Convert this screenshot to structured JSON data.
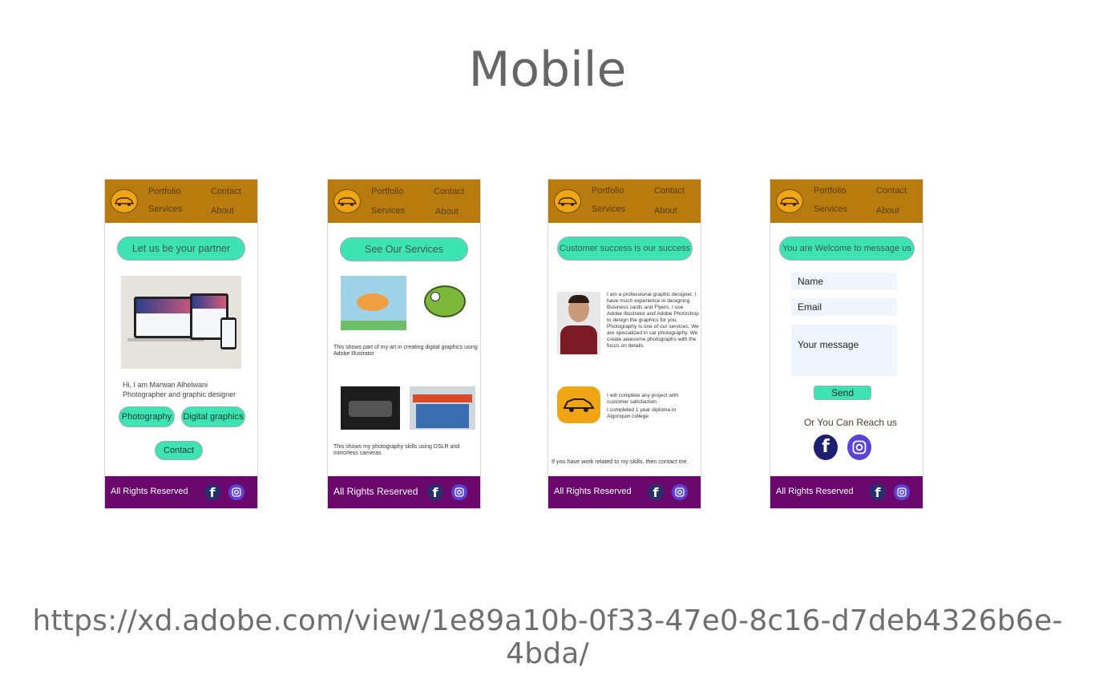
{
  "slide": {
    "title": "Mobile",
    "url": "https://xd.adobe.com/view/1e89a10b-0f33-47e0-8c16-d7deb4326b6e-4bda/"
  },
  "nav": {
    "portfolio": "Portfolio",
    "contact": "Contact",
    "services": "Services",
    "about": "About"
  },
  "footer": {
    "text": "All Rights Reserved",
    "icons": [
      "facebook-icon",
      "instagram-icon"
    ]
  },
  "screens": {
    "home": {
      "heading": "Let us be your partner",
      "intro_line1": "Hi, I am Marwan Alhelwani",
      "intro_line2": "Photographer and graphic designer",
      "btn_photography": "Photography",
      "btn_digital": "Digital graphics",
      "btn_contact": "Contact"
    },
    "services": {
      "heading": "See Our Services",
      "caption_graphics": "This shows part of my art in creating digital graphics using Adobe Illustrator",
      "caption_photo": "This shows my photography skills using DSLR and mirrorless cameras"
    },
    "about": {
      "heading": "Customer success is our success",
      "bio": "I am a professional graphic designer. I have much experience in designing Business cards and Flyers. I use Adobe Illustrator and Adobe Photoshop to design the graphics for you. Photography is one of our services. We are specialized in car photography. We create awesome photographs with the focus on details",
      "promise_line1": "I will complete any project with customer satisfaction.",
      "promise_line2": "I completed 1 year diploma in Algonquin college",
      "contact_note": "If you have work related to my skills, then contact me."
    },
    "contact": {
      "heading": "You are Welcome to message us",
      "name_placeholder": "Name",
      "email_placeholder": "Email",
      "message_placeholder": "Your message",
      "send_label": "Send",
      "reach_text": "Or You Can Reach us"
    }
  },
  "colors": {
    "header": "#b77c0d",
    "footer": "#6a086e",
    "accent": "#3ee3b4",
    "logo": "#efa514"
  }
}
